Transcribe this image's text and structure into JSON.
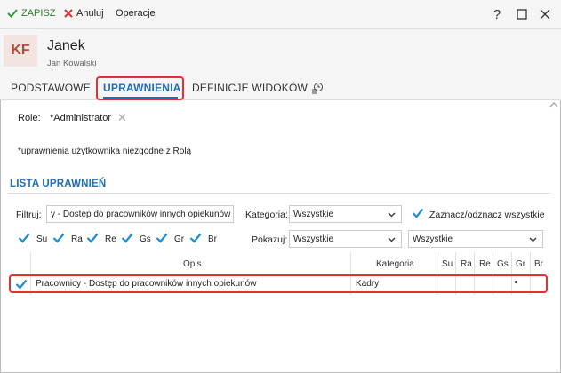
{
  "toolbar": {
    "save_label": "ZAPISZ",
    "cancel_label": "Anuluj",
    "operations_label": "Operacje",
    "help_label": "?"
  },
  "header": {
    "initials": "KF",
    "name": "Janek",
    "subtitle": "Jan Kowalski"
  },
  "tabs": [
    {
      "label": "PODSTAWOWE",
      "active": false
    },
    {
      "label": "UPRAWNIENIA",
      "active": true
    },
    {
      "label": "DEFINICJE WIDOKÓW",
      "active": false
    }
  ],
  "roles": {
    "label": "Role:",
    "value": "*Administrator"
  },
  "note": "*uprawnienia użytkownika niezgodne z Rolą",
  "section": {
    "title": "LISTA UPRAWNIEŃ"
  },
  "filters": {
    "filter_label": "Filtruj:",
    "filter_value": "y - Dostęp do pracowników innych opiekunów",
    "category_label": "Kategoria:",
    "category_value": "Wszystkie",
    "select_all_label": "Zaznacz/odznacz wszystkie",
    "show_label": "Pokazuj:",
    "show_value": "Wszystkie",
    "show_value2": "Wszystkie",
    "flags": [
      {
        "label": "Su",
        "checked": true
      },
      {
        "label": "Ra",
        "checked": true
      },
      {
        "label": "Re",
        "checked": true
      },
      {
        "label": "Gs",
        "checked": true
      },
      {
        "label": "Gr",
        "checked": true
      },
      {
        "label": "Br",
        "checked": true
      }
    ]
  },
  "table": {
    "columns": [
      "Opis",
      "Kategoria",
      "Su",
      "Ra",
      "Re",
      "Gs",
      "Gr",
      "Br"
    ],
    "rows": [
      {
        "checked": true,
        "opis": "Pracownicy - Dostęp do pracowników innych opiekunów",
        "kategoria": "Kadry",
        "gr": "•"
      }
    ]
  },
  "colors": {
    "accent": "#1f6fb5",
    "save": "#2e7d2e",
    "highlight": "#e03232",
    "avatar_bg": "#f2e4e0",
    "avatar_fg": "#b24a36"
  }
}
